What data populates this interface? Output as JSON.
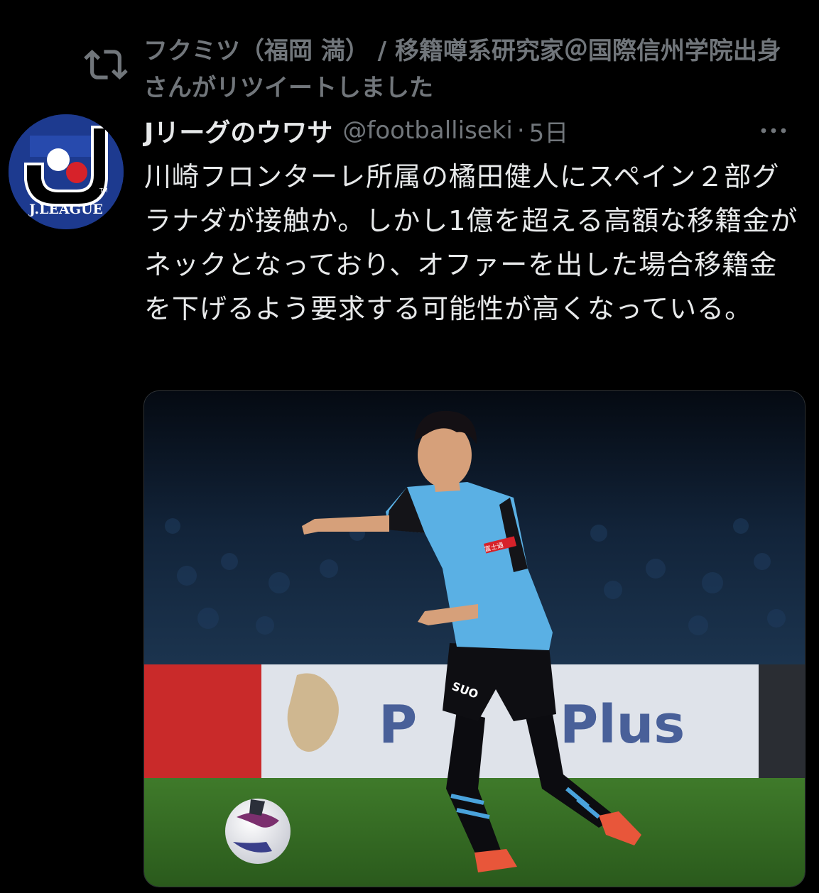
{
  "retweet": {
    "icon": "retweet-icon",
    "text": "フクミツ（福岡 満） / 移籍噂系研究家＠国際信州学院出身さんがリツイートしました"
  },
  "tweet": {
    "avatar": {
      "logo_text": "J.LEAGUE",
      "tm": "TM"
    },
    "display_name": "Jリーグのウワサ",
    "handle": "@footballiseki",
    "separator": "·",
    "time": "5日",
    "more_icon": "more-icon",
    "text": "川崎フロンターレ所属の橘田健人にスペイン２部グラナダが接触か。しかし1億を超える高額な移籍金がネックとなっており、オファーを出した場合移籍金を下げるよう要求する可能性が高くなっている。",
    "media": {
      "description": "photo",
      "board_text": "Plus",
      "shorts_text": "SUO",
      "shirt_text": "富士通"
    }
  },
  "colors": {
    "background": "#000000",
    "primary_text": "#e7e9ea",
    "secondary_text": "#71767b",
    "jleague_blue": "#1d3a8f",
    "jleague_red": "#d7222a",
    "frontale_blue": "#4aa3dc"
  }
}
